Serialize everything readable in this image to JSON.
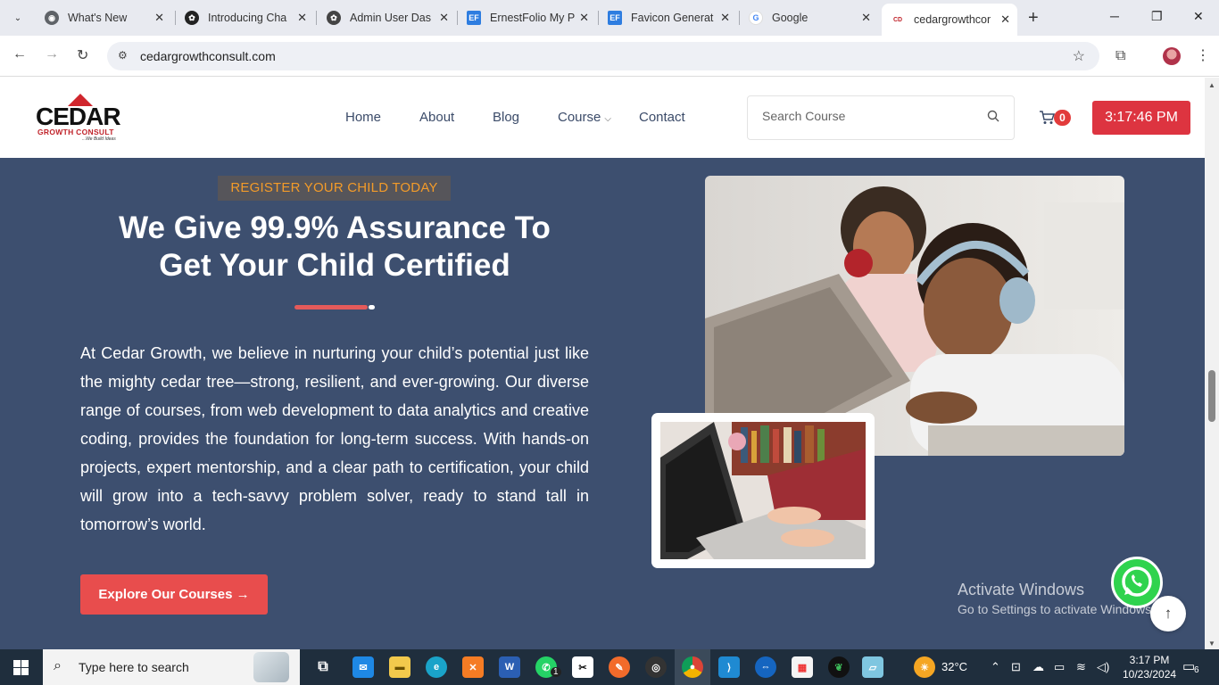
{
  "browser": {
    "tabs": [
      {
        "title": "What's New",
        "favicon": "chrome-icon"
      },
      {
        "title": "Introducing Cha",
        "favicon": "openai-icon"
      },
      {
        "title": "Admin User Das",
        "favicon": "openai-icon"
      },
      {
        "title": "ErnestFolio My P",
        "favicon": "ef-icon"
      },
      {
        "title": "Favicon Generat",
        "favicon": "ef-icon"
      },
      {
        "title": "Google",
        "favicon": "google-icon"
      },
      {
        "title": "cedargrowthcon",
        "favicon": "cedar-icon",
        "active": true
      }
    ],
    "url": "cedargrowthconsult.com"
  },
  "site": {
    "logo": {
      "word": "CEDAR",
      "sub": "GROWTH CONSULT",
      "tagline": "...We Build Ideas"
    },
    "nav": [
      "Home",
      "About",
      "Blog",
      "Course",
      "Contact"
    ],
    "search_placeholder": "Search Course",
    "cart_count": "0",
    "clock": "3:17:46 PM"
  },
  "hero": {
    "kicker": "REGISTER YOUR CHILD TODAY",
    "headline_1": "We Give 99.9% Assurance To",
    "headline_2": "Get Your Child Certified",
    "body": "At Cedar Growth, we believe in nurturing your child’s potential just like the mighty cedar tree—strong, resilient, and ever-growing. Our diverse range of courses, from web development to data analytics and creative coding, provides the foundation for long-term success. With hands-on projects, expert mentorship, and a clear path to certification, your child will grow into a tech-savvy problem solver, ready to stand tall in tomorrow’s world.",
    "cta": "Explore Our Courses →"
  },
  "overlay": {
    "activate_title": "Activate Windows",
    "activate_sub": "Go to Settings to activate Windows."
  },
  "taskbar": {
    "search_text": "Type here to search",
    "weather": "32°C",
    "time": "3:17 PM",
    "date": "10/23/2024",
    "notif_count": "6",
    "whatsapp_badge": "1"
  },
  "colors": {
    "hero_bg": "#3d4f6f",
    "accent_red": "#e84d4d",
    "kicker_orange": "#f39b29",
    "nav_text": "#3b4b69"
  }
}
